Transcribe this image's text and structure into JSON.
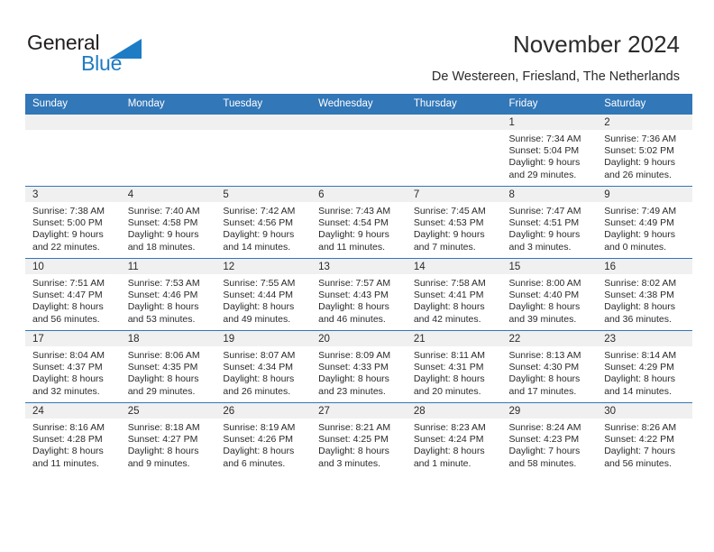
{
  "brand": {
    "name_part1": "General",
    "name_part2": "Blue",
    "triangle_icon": "triangle-icon",
    "accent_color": "#1d7cc4"
  },
  "header": {
    "title": "November 2024",
    "subtitle": "De Westereen, Friesland, The Netherlands"
  },
  "colors": {
    "header_blue": "#3277B8",
    "daynum_band": "#f0f0f0",
    "text": "#2a2a2a"
  },
  "calendar": {
    "weekday_headers": [
      "Sunday",
      "Monday",
      "Tuesday",
      "Wednesday",
      "Thursday",
      "Friday",
      "Saturday"
    ],
    "labels": {
      "sunrise": "Sunrise:",
      "sunset": "Sunset:",
      "daylight": "Daylight:"
    },
    "weeks": [
      [
        {
          "blank": true
        },
        {
          "blank": true
        },
        {
          "blank": true
        },
        {
          "blank": true
        },
        {
          "blank": true
        },
        {
          "day": "1",
          "sunrise": "Sunrise: 7:34 AM",
          "sunset": "Sunset: 5:04 PM",
          "daylight": "Daylight: 9 hours and 29 minutes."
        },
        {
          "day": "2",
          "sunrise": "Sunrise: 7:36 AM",
          "sunset": "Sunset: 5:02 PM",
          "daylight": "Daylight: 9 hours and 26 minutes."
        }
      ],
      [
        {
          "day": "3",
          "sunrise": "Sunrise: 7:38 AM",
          "sunset": "Sunset: 5:00 PM",
          "daylight": "Daylight: 9 hours and 22 minutes."
        },
        {
          "day": "4",
          "sunrise": "Sunrise: 7:40 AM",
          "sunset": "Sunset: 4:58 PM",
          "daylight": "Daylight: 9 hours and 18 minutes."
        },
        {
          "day": "5",
          "sunrise": "Sunrise: 7:42 AM",
          "sunset": "Sunset: 4:56 PM",
          "daylight": "Daylight: 9 hours and 14 minutes."
        },
        {
          "day": "6",
          "sunrise": "Sunrise: 7:43 AM",
          "sunset": "Sunset: 4:54 PM",
          "daylight": "Daylight: 9 hours and 11 minutes."
        },
        {
          "day": "7",
          "sunrise": "Sunrise: 7:45 AM",
          "sunset": "Sunset: 4:53 PM",
          "daylight": "Daylight: 9 hours and 7 minutes."
        },
        {
          "day": "8",
          "sunrise": "Sunrise: 7:47 AM",
          "sunset": "Sunset: 4:51 PM",
          "daylight": "Daylight: 9 hours and 3 minutes."
        },
        {
          "day": "9",
          "sunrise": "Sunrise: 7:49 AM",
          "sunset": "Sunset: 4:49 PM",
          "daylight": "Daylight: 9 hours and 0 minutes."
        }
      ],
      [
        {
          "day": "10",
          "sunrise": "Sunrise: 7:51 AM",
          "sunset": "Sunset: 4:47 PM",
          "daylight": "Daylight: 8 hours and 56 minutes."
        },
        {
          "day": "11",
          "sunrise": "Sunrise: 7:53 AM",
          "sunset": "Sunset: 4:46 PM",
          "daylight": "Daylight: 8 hours and 53 minutes."
        },
        {
          "day": "12",
          "sunrise": "Sunrise: 7:55 AM",
          "sunset": "Sunset: 4:44 PM",
          "daylight": "Daylight: 8 hours and 49 minutes."
        },
        {
          "day": "13",
          "sunrise": "Sunrise: 7:57 AM",
          "sunset": "Sunset: 4:43 PM",
          "daylight": "Daylight: 8 hours and 46 minutes."
        },
        {
          "day": "14",
          "sunrise": "Sunrise: 7:58 AM",
          "sunset": "Sunset: 4:41 PM",
          "daylight": "Daylight: 8 hours and 42 minutes."
        },
        {
          "day": "15",
          "sunrise": "Sunrise: 8:00 AM",
          "sunset": "Sunset: 4:40 PM",
          "daylight": "Daylight: 8 hours and 39 minutes."
        },
        {
          "day": "16",
          "sunrise": "Sunrise: 8:02 AM",
          "sunset": "Sunset: 4:38 PM",
          "daylight": "Daylight: 8 hours and 36 minutes."
        }
      ],
      [
        {
          "day": "17",
          "sunrise": "Sunrise: 8:04 AM",
          "sunset": "Sunset: 4:37 PM",
          "daylight": "Daylight: 8 hours and 32 minutes."
        },
        {
          "day": "18",
          "sunrise": "Sunrise: 8:06 AM",
          "sunset": "Sunset: 4:35 PM",
          "daylight": "Daylight: 8 hours and 29 minutes."
        },
        {
          "day": "19",
          "sunrise": "Sunrise: 8:07 AM",
          "sunset": "Sunset: 4:34 PM",
          "daylight": "Daylight: 8 hours and 26 minutes."
        },
        {
          "day": "20",
          "sunrise": "Sunrise: 8:09 AM",
          "sunset": "Sunset: 4:33 PM",
          "daylight": "Daylight: 8 hours and 23 minutes."
        },
        {
          "day": "21",
          "sunrise": "Sunrise: 8:11 AM",
          "sunset": "Sunset: 4:31 PM",
          "daylight": "Daylight: 8 hours and 20 minutes."
        },
        {
          "day": "22",
          "sunrise": "Sunrise: 8:13 AM",
          "sunset": "Sunset: 4:30 PM",
          "daylight": "Daylight: 8 hours and 17 minutes."
        },
        {
          "day": "23",
          "sunrise": "Sunrise: 8:14 AM",
          "sunset": "Sunset: 4:29 PM",
          "daylight": "Daylight: 8 hours and 14 minutes."
        }
      ],
      [
        {
          "day": "24",
          "sunrise": "Sunrise: 8:16 AM",
          "sunset": "Sunset: 4:28 PM",
          "daylight": "Daylight: 8 hours and 11 minutes."
        },
        {
          "day": "25",
          "sunrise": "Sunrise: 8:18 AM",
          "sunset": "Sunset: 4:27 PM",
          "daylight": "Daylight: 8 hours and 9 minutes."
        },
        {
          "day": "26",
          "sunrise": "Sunrise: 8:19 AM",
          "sunset": "Sunset: 4:26 PM",
          "daylight": "Daylight: 8 hours and 6 minutes."
        },
        {
          "day": "27",
          "sunrise": "Sunrise: 8:21 AM",
          "sunset": "Sunset: 4:25 PM",
          "daylight": "Daylight: 8 hours and 3 minutes."
        },
        {
          "day": "28",
          "sunrise": "Sunrise: 8:23 AM",
          "sunset": "Sunset: 4:24 PM",
          "daylight": "Daylight: 8 hours and 1 minute."
        },
        {
          "day": "29",
          "sunrise": "Sunrise: 8:24 AM",
          "sunset": "Sunset: 4:23 PM",
          "daylight": "Daylight: 7 hours and 58 minutes."
        },
        {
          "day": "30",
          "sunrise": "Sunrise: 8:26 AM",
          "sunset": "Sunset: 4:22 PM",
          "daylight": "Daylight: 7 hours and 56 minutes."
        }
      ]
    ]
  }
}
